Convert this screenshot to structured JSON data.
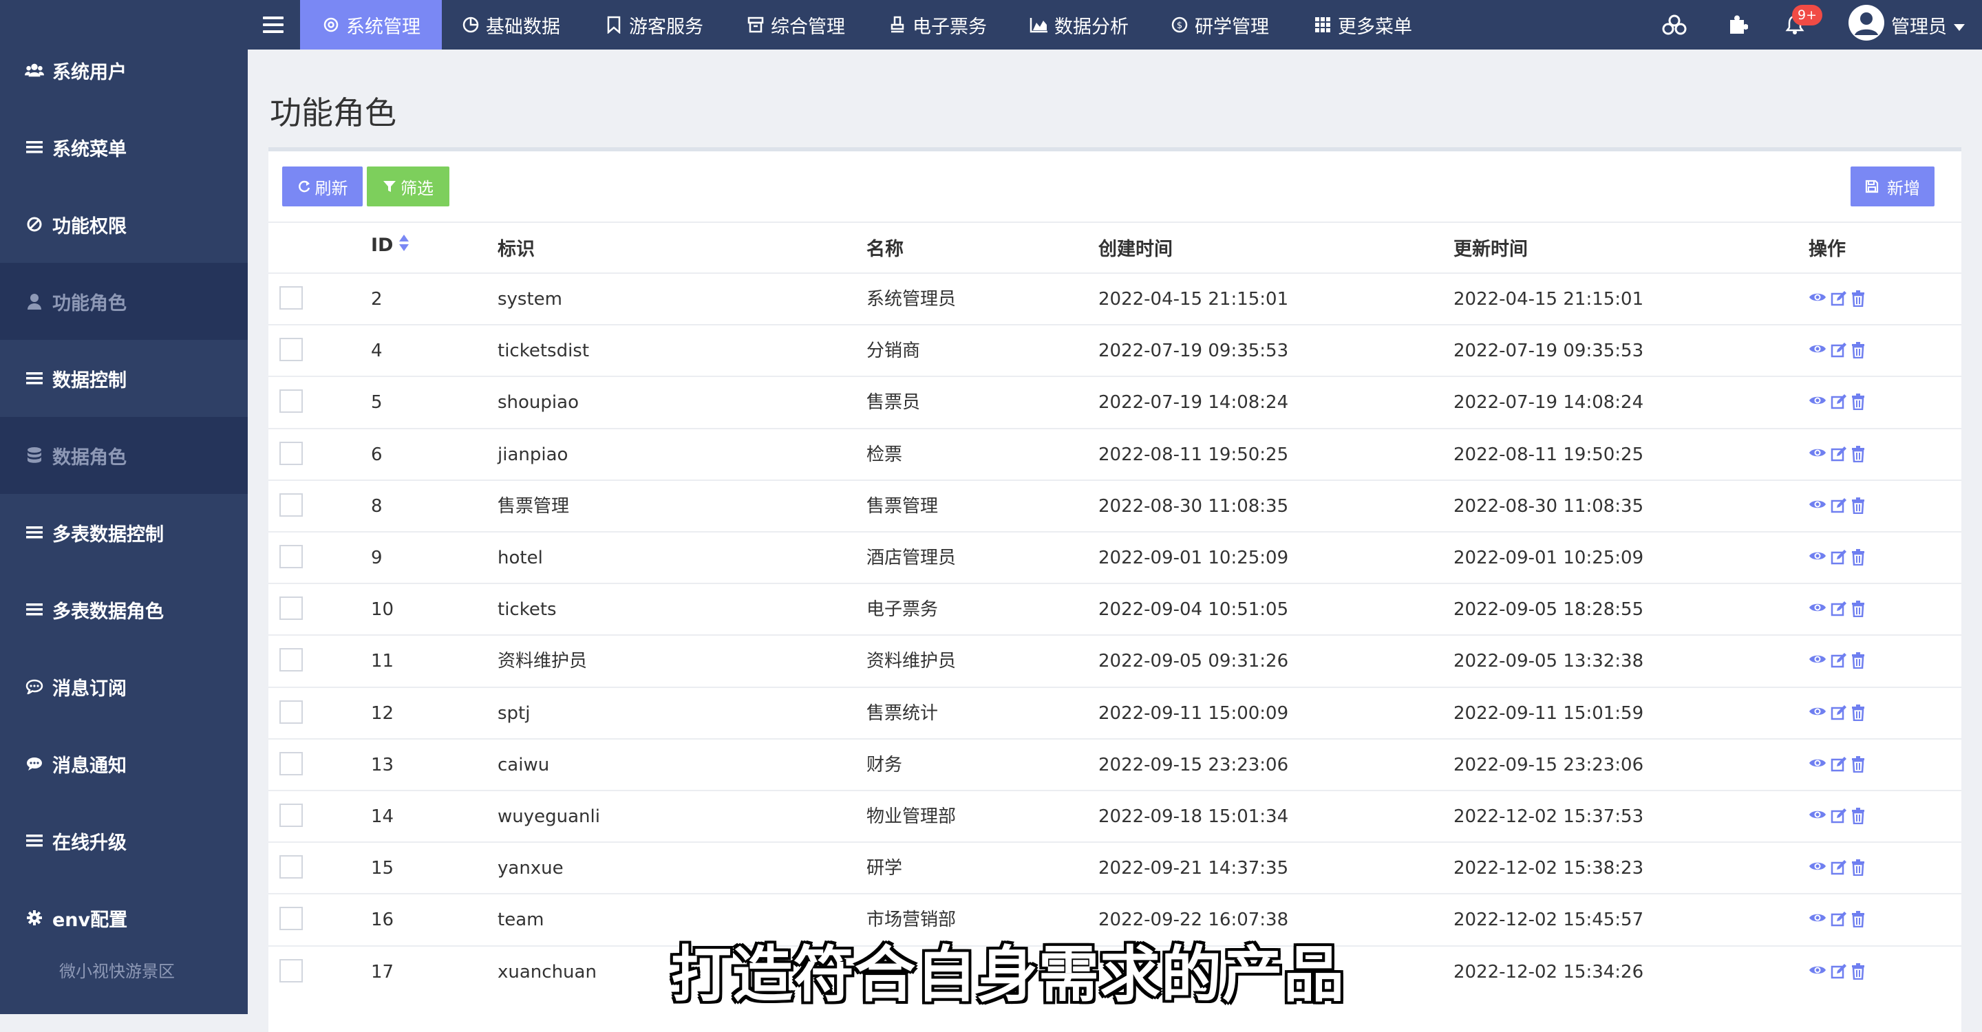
{
  "topnav": {
    "items": [
      {
        "label": "系统管理",
        "icon": "gear-icon",
        "active": true
      },
      {
        "label": "基础数据",
        "icon": "pie-icon"
      },
      {
        "label": "游客服务",
        "icon": "bookmark-icon"
      },
      {
        "label": "综合管理",
        "icon": "archive-icon"
      },
      {
        "label": "电子票务",
        "icon": "stamp-icon"
      },
      {
        "label": "数据分析",
        "icon": "area-chart-icon"
      },
      {
        "label": "研学管理",
        "icon": "coin-icon"
      },
      {
        "label": "更多菜单",
        "icon": "grid-icon"
      }
    ],
    "notification_count": "9+",
    "user_label": "管理员"
  },
  "sidebar": {
    "items": [
      {
        "label": "系统用户",
        "icon": "users-icon"
      },
      {
        "label": "系统菜单",
        "icon": "list-icon"
      },
      {
        "label": "功能权限",
        "icon": "ban-icon"
      },
      {
        "label": "功能角色",
        "icon": "user-icon",
        "active": true
      },
      {
        "label": "数据控制",
        "icon": "list-icon"
      },
      {
        "label": "数据角色",
        "icon": "database-icon",
        "active": true
      },
      {
        "label": "多表数据控制",
        "icon": "list-icon"
      },
      {
        "label": "多表数据角色",
        "icon": "list-icon"
      },
      {
        "label": "消息订阅",
        "icon": "comment-outline-icon"
      },
      {
        "label": "消息通知",
        "icon": "comment-icon"
      },
      {
        "label": "在线升级",
        "icon": "list-icon"
      },
      {
        "label": "env配置",
        "icon": "gear-icon"
      }
    ],
    "footer": "微小视快游景区"
  },
  "page": {
    "title": "功能角色"
  },
  "toolbar": {
    "refresh_label": "刷新",
    "filter_label": "筛选",
    "add_label": "新增"
  },
  "table": {
    "headers": {
      "id": "ID",
      "code": "标识",
      "name": "名称",
      "created": "创建时间",
      "updated": "更新时间",
      "ops": "操作"
    },
    "rows": [
      {
        "id": "2",
        "code": "system",
        "name": "系统管理员",
        "created": "2022-04-15 21:15:01",
        "updated": "2022-04-15 21:15:01"
      },
      {
        "id": "4",
        "code": "ticketsdist",
        "name": "分销商",
        "created": "2022-07-19 09:35:53",
        "updated": "2022-07-19 09:35:53"
      },
      {
        "id": "5",
        "code": "shoupiao",
        "name": "售票员",
        "created": "2022-07-19 14:08:24",
        "updated": "2022-07-19 14:08:24"
      },
      {
        "id": "6",
        "code": "jianpiao",
        "name": "检票",
        "created": "2022-08-11 19:50:25",
        "updated": "2022-08-11 19:50:25"
      },
      {
        "id": "8",
        "code": "售票管理",
        "name": "售票管理",
        "created": "2022-08-30 11:08:35",
        "updated": "2022-08-30 11:08:35"
      },
      {
        "id": "9",
        "code": "hotel",
        "name": "酒店管理员",
        "created": "2022-09-01 10:25:09",
        "updated": "2022-09-01 10:25:09"
      },
      {
        "id": "10",
        "code": "tickets",
        "name": "电子票务",
        "created": "2022-09-04 10:51:05",
        "updated": "2022-09-05 18:28:55"
      },
      {
        "id": "11",
        "code": "资料维护员",
        "name": "资料维护员",
        "created": "2022-09-05 09:31:26",
        "updated": "2022-09-05 13:32:38"
      },
      {
        "id": "12",
        "code": "sptj",
        "name": "售票统计",
        "created": "2022-09-11 15:00:09",
        "updated": "2022-09-11 15:01:59"
      },
      {
        "id": "13",
        "code": "caiwu",
        "name": "财务",
        "created": "2022-09-15 23:23:06",
        "updated": "2022-09-15 23:23:06"
      },
      {
        "id": "14",
        "code": "wuyeguanli",
        "name": "物业管理部",
        "created": "2022-09-18 15:01:34",
        "updated": "2022-12-02 15:37:53"
      },
      {
        "id": "15",
        "code": "yanxue",
        "name": "研学",
        "created": "2022-09-21 14:37:35",
        "updated": "2022-12-02 15:38:23"
      },
      {
        "id": "16",
        "code": "team",
        "name": "市场营销部",
        "created": "2022-09-22 16:07:38",
        "updated": "2022-12-02 15:45:57"
      },
      {
        "id": "17",
        "code": "xuanchuan",
        "name": "",
        "created": "",
        "updated": "2022-12-02 15:34:26"
      }
    ]
  },
  "subtitle": "打造符合自身需求的产品",
  "colors": {
    "nav_bg": "#2f4066",
    "active": "#7a88f4",
    "filter_btn": "#7dcf5c",
    "icon_blue": "#6f7ff0",
    "badge": "#f04b45"
  }
}
